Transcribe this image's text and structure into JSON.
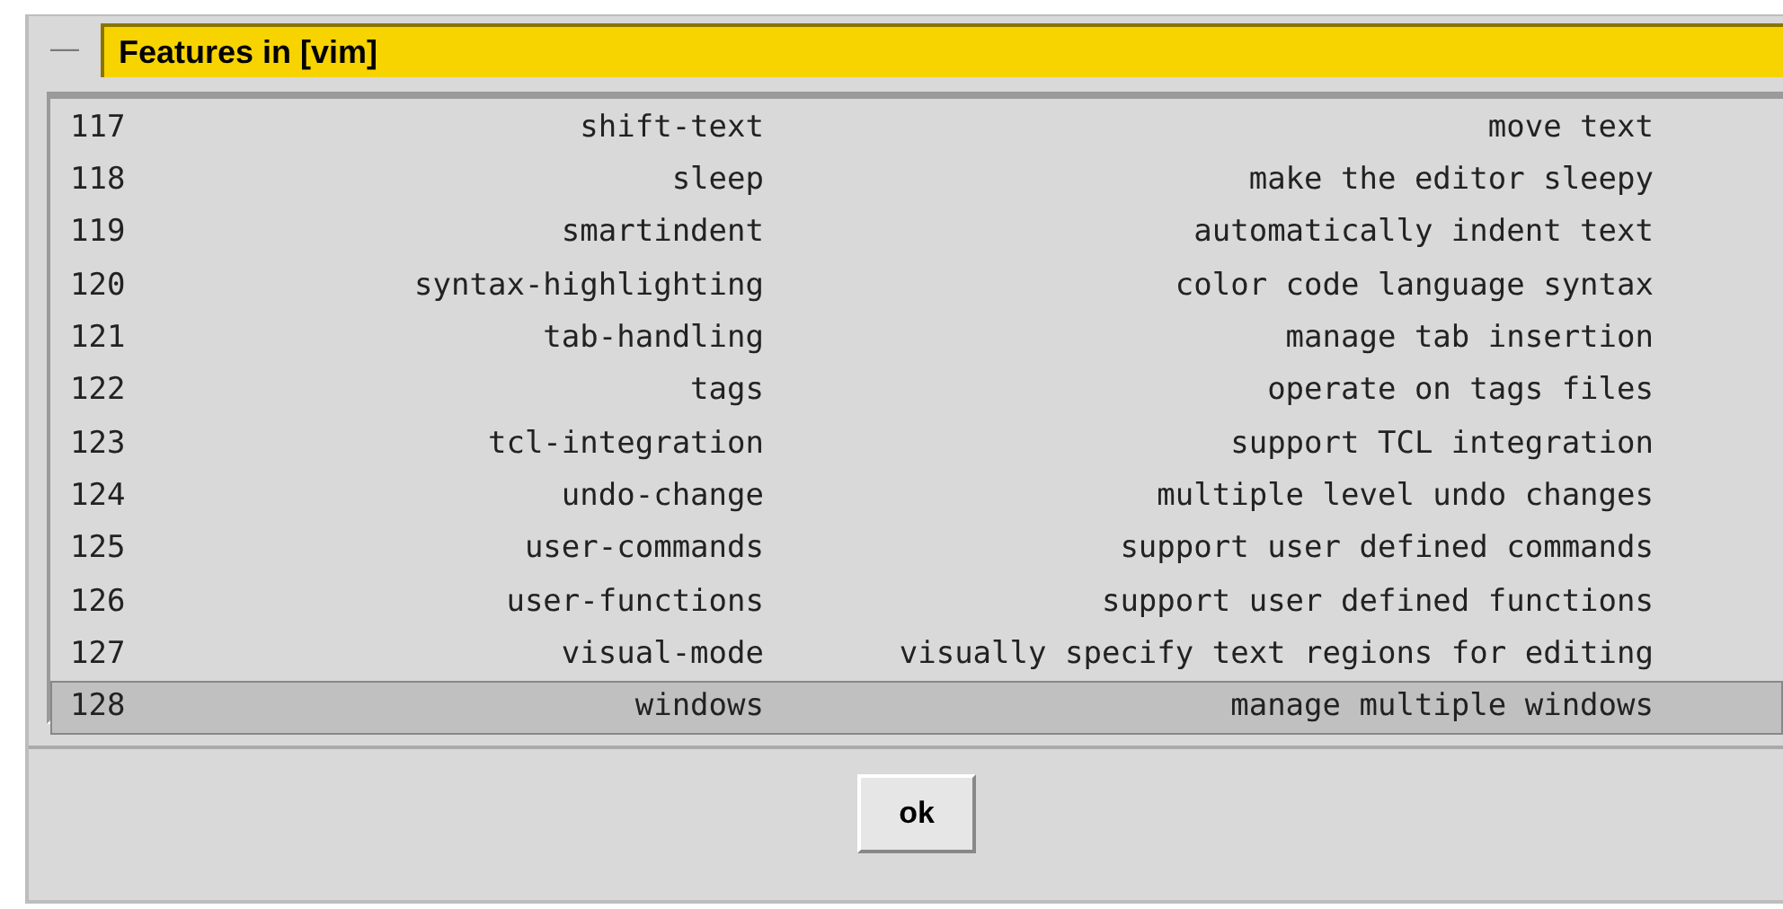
{
  "window": {
    "title": "Features in [vim]",
    "menu_glyph": "—"
  },
  "features": [
    {
      "number": "117",
      "name": "shift-text",
      "description": "move text",
      "selected": false
    },
    {
      "number": "118",
      "name": "sleep",
      "description": "make the editor sleepy",
      "selected": false
    },
    {
      "number": "119",
      "name": "smartindent",
      "description": "automatically indent text",
      "selected": false
    },
    {
      "number": "120",
      "name": "syntax-highlighting",
      "description": "color code language syntax",
      "selected": false
    },
    {
      "number": "121",
      "name": "tab-handling",
      "description": "manage tab insertion",
      "selected": false
    },
    {
      "number": "122",
      "name": "tags",
      "description": "operate on tags files",
      "selected": false
    },
    {
      "number": "123",
      "name": "tcl-integration",
      "description": "support TCL integration",
      "selected": false
    },
    {
      "number": "124",
      "name": "undo-change",
      "description": "multiple level undo changes",
      "selected": false
    },
    {
      "number": "125",
      "name": "user-commands",
      "description": "support user defined commands",
      "selected": false
    },
    {
      "number": "126",
      "name": "user-functions",
      "description": "support user defined functions",
      "selected": false
    },
    {
      "number": "127",
      "name": "visual-mode",
      "description": "visually specify text regions for editing",
      "selected": false
    },
    {
      "number": "128",
      "name": "windows",
      "description": "manage multiple windows",
      "selected": true
    }
  ],
  "buttons": [
    {
      "label": "ok"
    }
  ]
}
